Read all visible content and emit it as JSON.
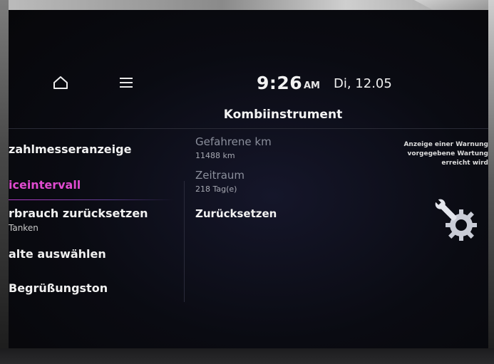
{
  "status_bar": {
    "time": "9:26",
    "ampm": "AM",
    "date": "Di, 12.05"
  },
  "header": {
    "title": "Kombiinstrument"
  },
  "icons": {
    "home": "home-icon",
    "menu": "menu-icon",
    "service": "gear-wrench-icon"
  },
  "menu": {
    "items": [
      {
        "label": "zahlmesseranzeige"
      },
      {
        "label": "iceintervall",
        "active": true
      },
      {
        "label": "rbrauch zurücksetzen",
        "sub": "Tanken"
      },
      {
        "label": "alte auswählen"
      },
      {
        "label": "Begrüßungston"
      }
    ]
  },
  "details": {
    "distance_label": "Gefahrene km",
    "distance_value": "11488 km",
    "period_label": "Zeitraum",
    "period_value": "218 Tag(e)",
    "reset_label": "Zurücksetzen"
  },
  "info": {
    "lines": [
      "Anzeige einer Warnung",
      "vorgegebene Wartung",
      "erreicht wird"
    ]
  },
  "colors": {
    "accent": "#e04bd0",
    "background": "#0a0b12"
  }
}
